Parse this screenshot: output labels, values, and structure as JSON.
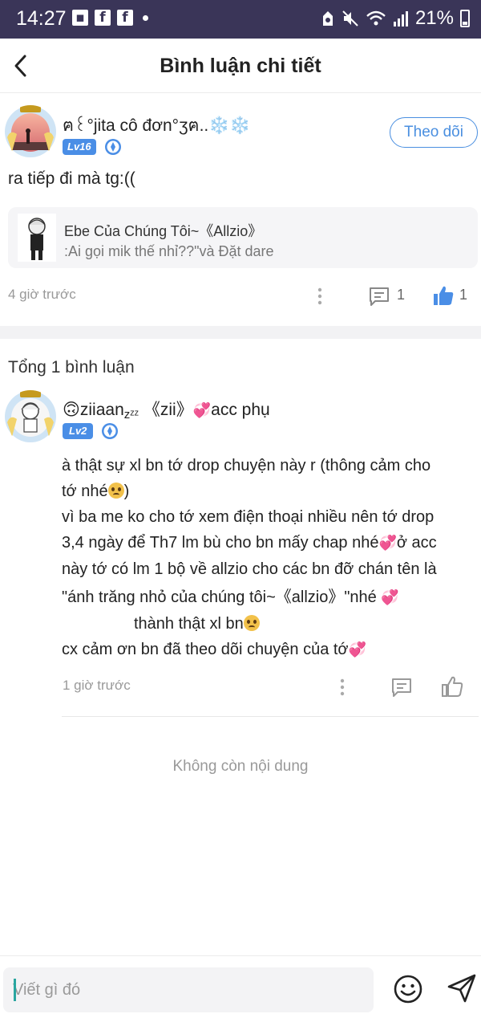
{
  "status_bar": {
    "time": "14:27",
    "battery_percent": "21%",
    "app_icons": [
      "image-icon",
      "facebook-icon",
      "facebook-icon"
    ]
  },
  "header": {
    "title": "Bình luận chi tiết"
  },
  "post": {
    "username": "ฅ꒰°jita cô đơn°ʒฅ..❄️❄️",
    "level": "Lv16",
    "follow_label": "Theo dõi",
    "text": "ra tiếp đi mà tg:((",
    "quoted": {
      "title": "Ebe Của Chúng Tôi~《Allzio》",
      "subtitle": ":Ai gọi mik thế nhỉ??\"và Đặt dare"
    },
    "time": "4 giờ trước",
    "comment_count": "1",
    "like_count": "1"
  },
  "replies_header": {
    "total_label": "Tổng 1 bình luận"
  },
  "reply": {
    "username_prefix": "🙃ziiaan",
    "username_zz": "zᶻᶻ",
    "username_mid": "《zii》",
    "username_suffix": "acc phụ",
    "level": "Lv2",
    "lines": [
      "à thật sự xl bn tớ drop chuyện này r (thông cảm cho",
      "tớ nhé",
      "vì ba me ko cho tớ xem điện thoại nhiều nên tớ drop",
      "3,4 ngày để Th7 lm bù cho bn mấy chap nhé",
      "ở acc",
      "này tớ có lm 1 bộ về allzio cho các bn đỡ chán tên là",
      "\"ánh trăng nhỏ của chúng tôi~《allzio》\"nhé",
      "thành thật xl bn",
      "cx cảm ơn bn đã theo dõi chuyện của tớ"
    ],
    "close_paren": ")",
    "time": "1 giờ trước"
  },
  "end_message": "Không còn nội dung",
  "input": {
    "placeholder": "Viết gì đó"
  },
  "colors": {
    "status_bar_bg": "#3a3558",
    "accent_blue": "#4a8fe0",
    "heart_pink": "#e84aa6"
  }
}
